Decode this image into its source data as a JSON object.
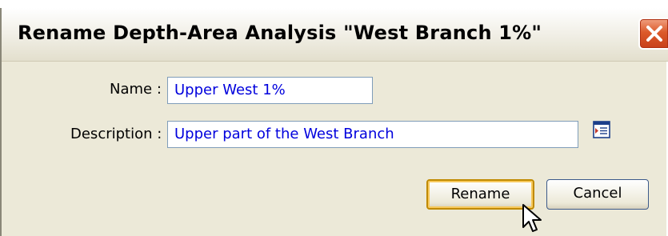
{
  "dialog": {
    "title": "Rename Depth-Area Analysis \"West Branch 1%\"",
    "close_icon": "close-icon"
  },
  "form": {
    "name_label": "Name :",
    "name_value": "Upper West 1%",
    "description_label": "Description :",
    "description_value": "Upper part of the West Branch",
    "browse_icon": "description-editor-icon"
  },
  "buttons": {
    "rename_label": "Rename",
    "cancel_label": "Cancel"
  },
  "colors": {
    "field_text": "#0000dd",
    "dialog_bg": "#ece9d8",
    "close_button": "#dc5a2a",
    "default_button_focus": "#f7c95c"
  }
}
